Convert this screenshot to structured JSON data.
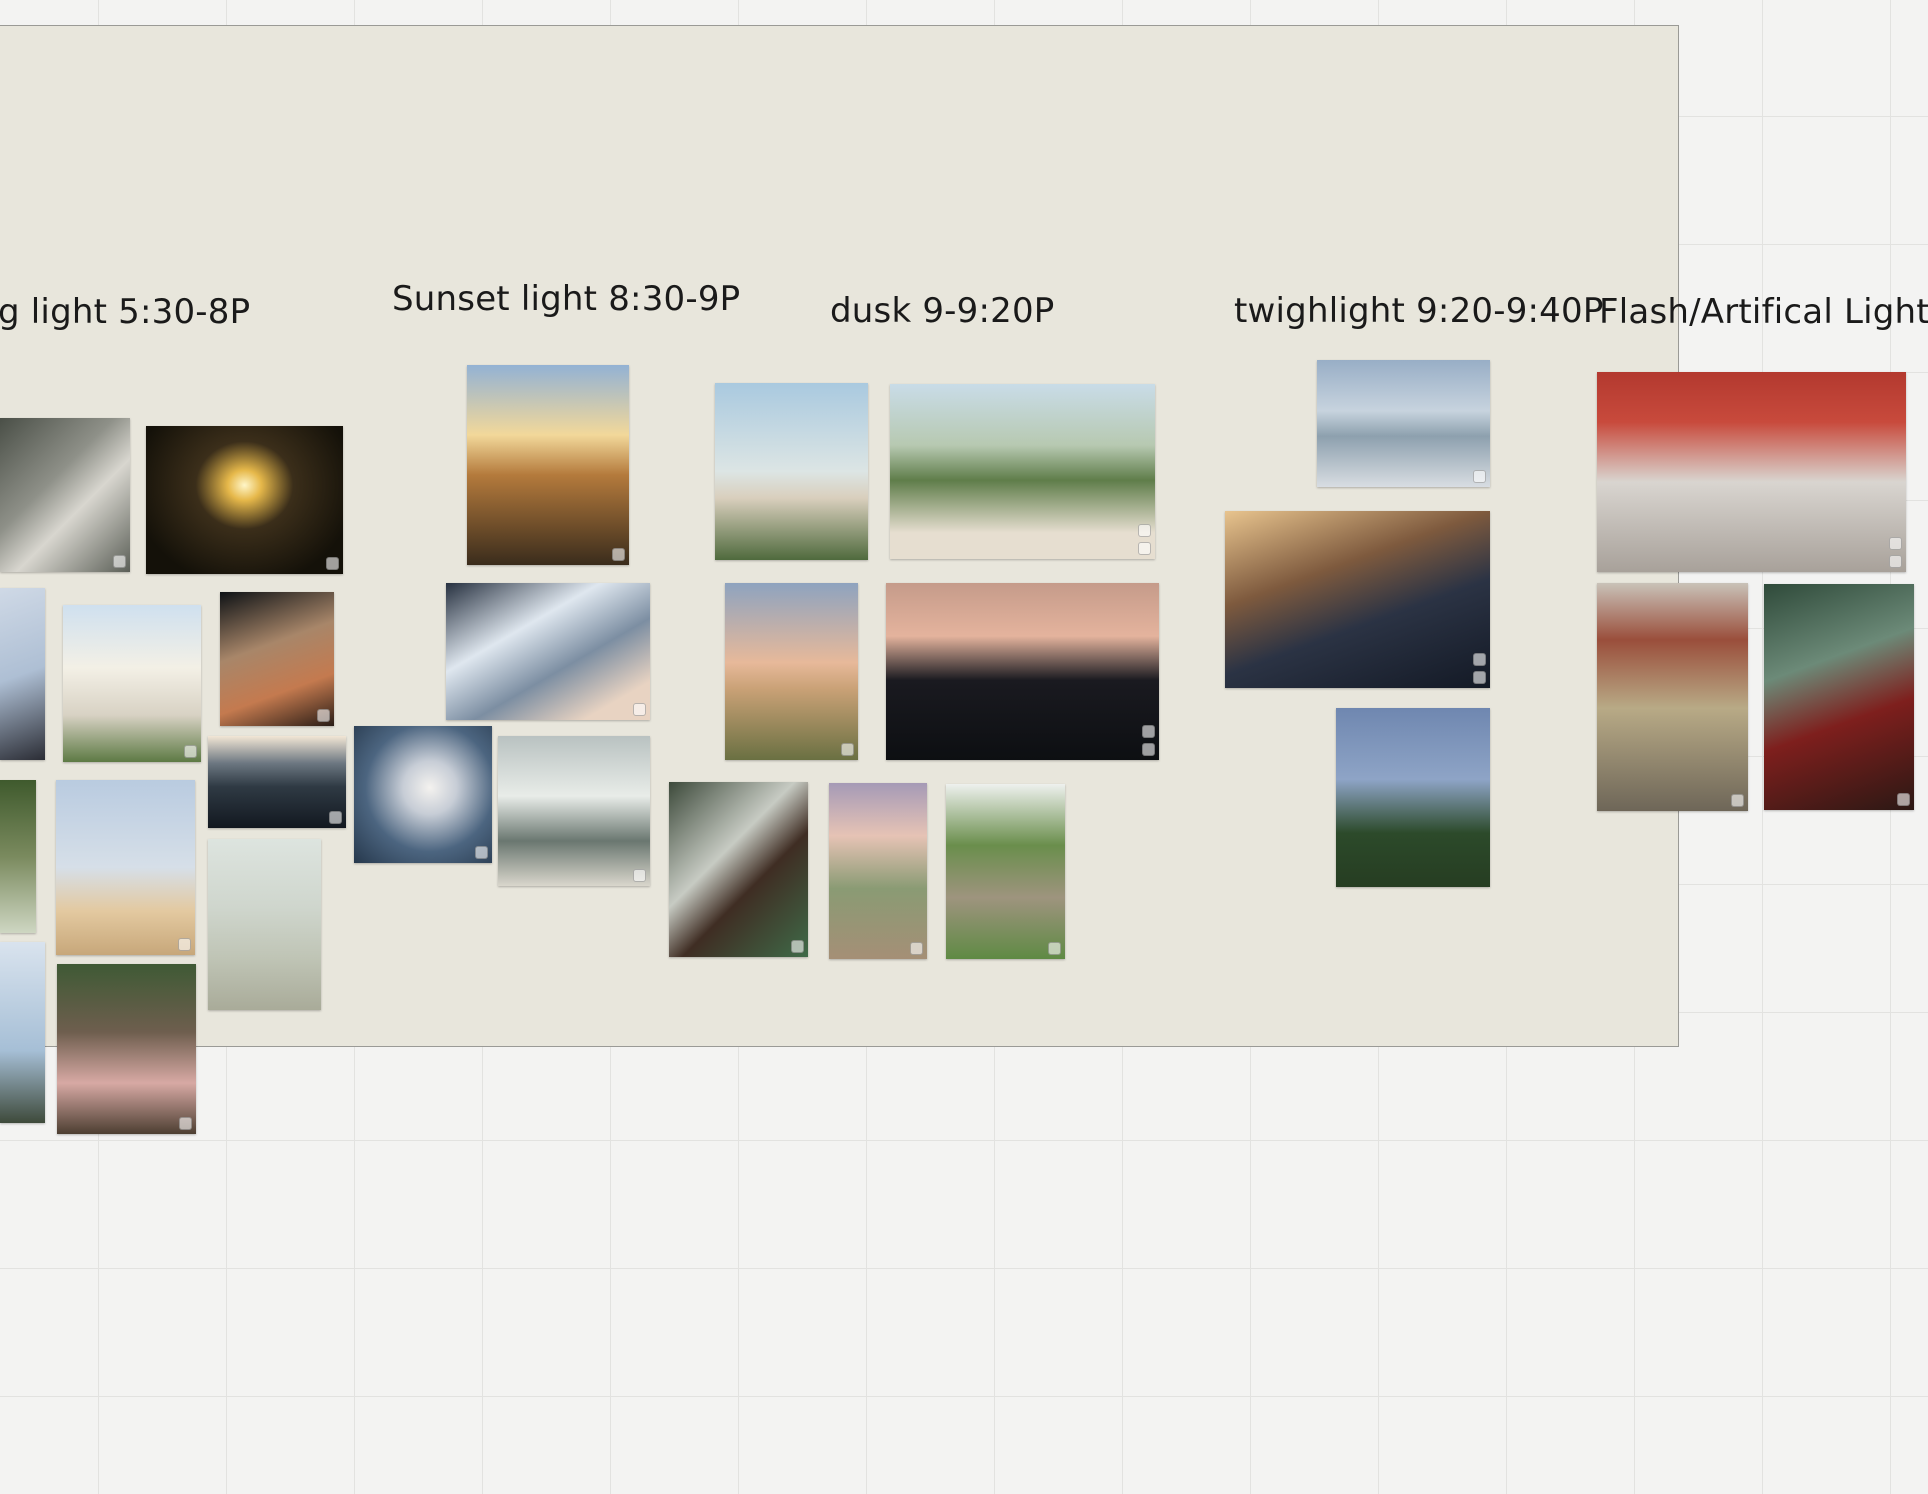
{
  "board": {
    "columns": [
      {
        "id": "golden",
        "title": "g light 5:30-8P"
      },
      {
        "id": "sunset",
        "title": "Sunset light 8:30-9P"
      },
      {
        "id": "dusk",
        "title": "dusk 9-9:20P"
      },
      {
        "id": "twilight",
        "title": "twighlight 9:20-9:40P"
      },
      {
        "id": "flash",
        "title": "Flash/Artifical Light"
      }
    ]
  },
  "photos": [
    {
      "name": "photo-window-dog",
      "bg": "linear-gradient(135deg,#4a4f47 0%,#8e9088 40%,#d8d6cf 60%,#5a5e56 100%)"
    },
    {
      "name": "photo-car-sun-glare",
      "bg": "radial-gradient(ellipse at 50% 40%,#fff6c8 0%,#e6b84a 12%,#3b2e1a 35%,#141109 80%)"
    },
    {
      "name": "photo-hair-wind",
      "bg": "linear-gradient(160deg,#cfd9e6 0%,#aebfd4 50%,#2b2d35 100%)"
    },
    {
      "name": "photo-flag-house",
      "bg": "linear-gradient(180deg,#cfe0ef 0%,#f3f0e6 40%,#d8d2c4 70%,#5d7a44 100%)"
    },
    {
      "name": "photo-car-window-dunes",
      "bg": "linear-gradient(160deg,#0e1215 0%,#a88669 40%,#c47a4f 70%,#2a1d16 100%)"
    },
    {
      "name": "photo-tree-house",
      "bg": "linear-gradient(180deg,#3f5a2d 0%,#7a8a5e 50%,#ced6c2 100%)"
    },
    {
      "name": "photo-birds-porch",
      "bg": "linear-gradient(180deg,#b9cbe0 0%,#d6dfe8 50%,#e3c9a0 75%,#c7a77a 100%)"
    },
    {
      "name": "photo-swimmers-lake",
      "bg": "linear-gradient(180deg,#f2e6d5 0%,#6b7680 30%,#2f3a44 55%,#121820 100%)"
    },
    {
      "name": "photo-beach-chair-haze",
      "bg": "linear-gradient(180deg,#dde4df 0%,#cfd6cd 40%,#bfc4b5 70%,#a9ab99 100%)"
    },
    {
      "name": "photo-swing-post",
      "bg": "linear-gradient(180deg,#d9e3ee 0%,#a6bfd6 60%,#3e4a3b 100%)"
    },
    {
      "name": "photo-girl-swing",
      "bg": "linear-gradient(180deg,#3f5a35 0%,#6e5e4e 40%,#d7a9a4 70%,#4d3f32 100%)"
    },
    {
      "name": "photo-sunset-grass",
      "bg": "linear-gradient(180deg,#93b2d4 0%,#f2d89a 35%,#b47a3c 55%,#3a2c1c 100%)"
    },
    {
      "name": "photo-feet-foam",
      "bg": "linear-gradient(150deg,#273140 0%,#dfe7ef 35%,#7c8ea2 60%,#e8d3c2 85%)"
    },
    {
      "name": "photo-cloud-silhouette",
      "bg": "radial-gradient(ellipse at 55% 45%,#f4f2ef 0%,#c7cdd6 25%,#4c6580 60%,#26384c 100%)"
    },
    {
      "name": "photo-legs-wave",
      "bg": "linear-gradient(180deg,#b9c2c1 0%,#e8ece8 40%,#6a7770 70%,#d9d6cc 100%)"
    },
    {
      "name": "photo-keep-off-dunes-sign",
      "bg": "linear-gradient(180deg,#a9c9df 0%,#dce5e4 50%,#d9cfbd 65%,#4f6a3d 100%)"
    },
    {
      "name": "photo-dune-grass",
      "bg": "linear-gradient(180deg,#c9dce8 0%,#b7c9b1 35%,#5f7d4a 55%,#e6ded0 85%)"
    },
    {
      "name": "photo-dusk-field",
      "bg": "linear-gradient(180deg,#8ea3bf 0%,#e7b99a 45%,#c9a176 60%,#6a7042 100%)"
    },
    {
      "name": "photo-dusk-storefront",
      "bg": "linear-gradient(180deg,#c59b8a 0%,#e4b39d 30%,#1a1a20 55%,#0d0f12 100%)"
    },
    {
      "name": "photo-woman-green",
      "bg": "linear-gradient(135deg,#3d4a3b 0%,#c7cbc3 40%,#3f2d23 60%,#3f6a48 100%)"
    },
    {
      "name": "photo-boardwalk-dunes",
      "bg": "linear-gradient(180deg,#a59ab6 0%,#e6c3b5 30%,#8a9b74 60%,#a58f76 100%)"
    },
    {
      "name": "photo-dirt-road",
      "bg": "linear-gradient(180deg,#eef1ee 0%,#6a8e4c 35%,#9e947e 65%,#5f8a44 100%)"
    },
    {
      "name": "photo-dune-twilight",
      "bg": "linear-gradient(180deg,#98aec6 0%,#c7d3de 40%,#8da0ae 60%,#d8dde2 100%)"
    },
    {
      "name": "photo-candle-porch-dinner",
      "bg": "linear-gradient(160deg,#e8c48e 0%,#7e5a3e 35%,#2b3344 60%,#131925 100%)"
    },
    {
      "name": "photo-firefly-finger",
      "bg": "linear-gradient(180deg,#6f87b0 0%,#8ea4c6 40%,#2c4a2a 70%,#263d22 100%)"
    },
    {
      "name": "photo-red-shirt-beer",
      "bg": "linear-gradient(180deg,#b3392f 0%,#c84a3c 25%,#d9d5d0 55%,#a8a19a 100%)"
    },
    {
      "name": "photo-store-aisle-milk",
      "bg": "linear-gradient(180deg,#c9c2b8 0%,#9a4e3b 25%,#b8aa86 55%,#6e6658 100%)"
    },
    {
      "name": "photo-coca-cola-bottles",
      "bg": "linear-gradient(160deg,#2f4a3a 0%,#6c8a78 35%,#7e1f1d 60%,#2b1814 100%)"
    }
  ]
}
